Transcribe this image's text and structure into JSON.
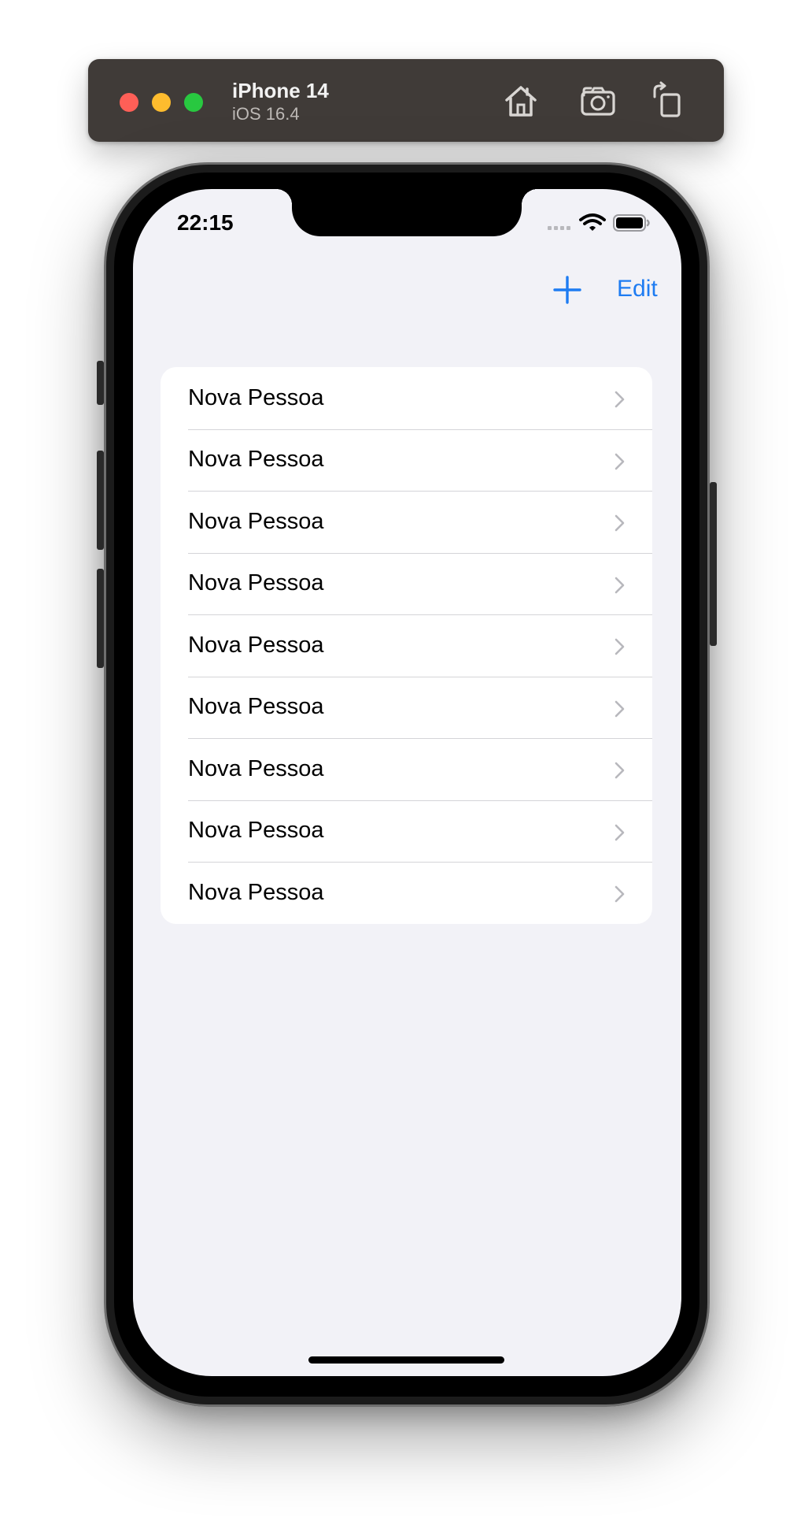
{
  "simulator": {
    "device_name": "iPhone 14",
    "os_version": "iOS 16.4",
    "icons": [
      "home-icon",
      "screenshot-icon",
      "rotate-icon"
    ]
  },
  "status_bar": {
    "time": "22:15",
    "icons": [
      "signal-icon",
      "wifi-icon",
      "battery-icon"
    ]
  },
  "nav_bar": {
    "add_icon": "plus-icon",
    "edit_label": "Edit",
    "accent_color": "#1e7cf2"
  },
  "list": {
    "items": [
      {
        "label": "Nova Pessoa"
      },
      {
        "label": "Nova Pessoa"
      },
      {
        "label": "Nova Pessoa"
      },
      {
        "label": "Nova Pessoa"
      },
      {
        "label": "Nova Pessoa"
      },
      {
        "label": "Nova Pessoa"
      },
      {
        "label": "Nova Pessoa"
      },
      {
        "label": "Nova Pessoa"
      },
      {
        "label": "Nova Pessoa"
      }
    ]
  },
  "colors": {
    "background": "#f2f2f7",
    "cell": "#ffffff",
    "separator": "#d4d4d8",
    "chevron": "#b8b8bd",
    "toolbar": "#403b38"
  }
}
